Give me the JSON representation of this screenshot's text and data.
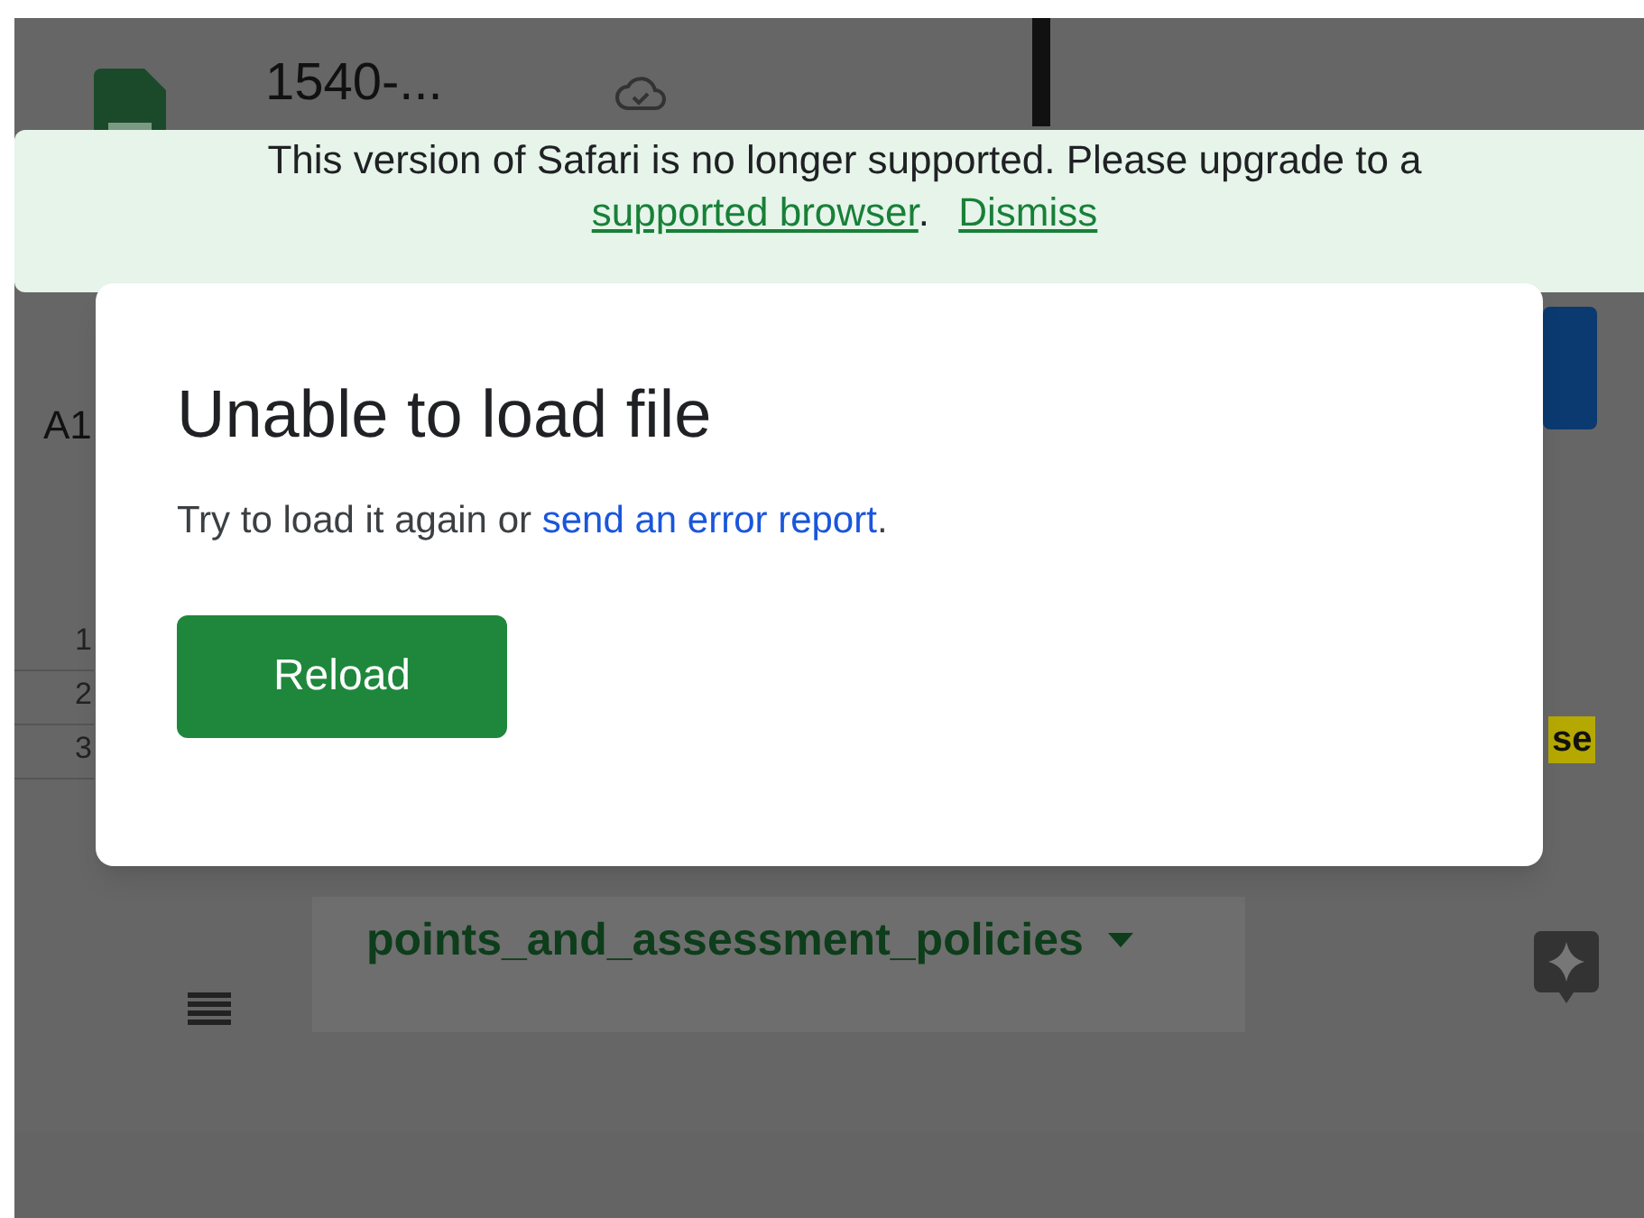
{
  "document": {
    "title": "1540-..."
  },
  "banner": {
    "message": "This version of Safari is no longer supported. Please upgrade to a",
    "link": "supported browser",
    "separator": ".",
    "dismiss": "Dismiss"
  },
  "dialog": {
    "title": "Unable to load file",
    "body": "Try to load it again or",
    "link": "send an error report",
    "end": ".",
    "button": "Reload"
  },
  "sheet": {
    "name_box": "A1",
    "rows": [
      "1",
      "2",
      "3"
    ],
    "cell_text": "se"
  },
  "sheet_tab": {
    "label": "points_and_assessment_policies",
    "selected": true
  }
}
